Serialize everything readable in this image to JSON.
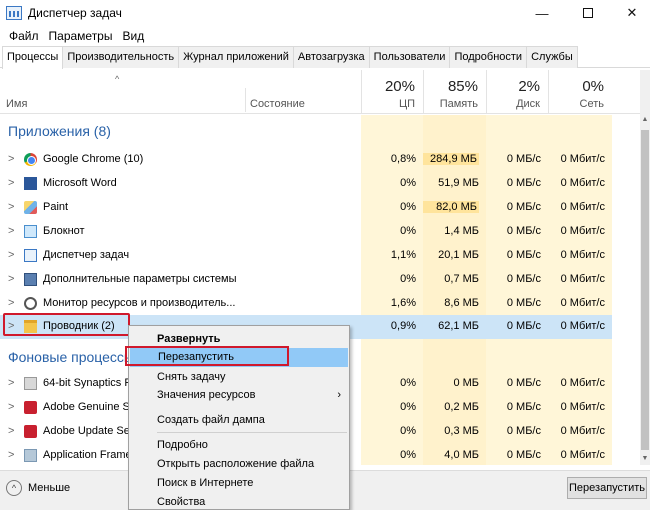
{
  "window": {
    "title": "Диспетчер задач",
    "minimize_glyph": "—",
    "close_glyph": "✕"
  },
  "menu": [
    "Файл",
    "Параметры",
    "Вид"
  ],
  "tabs": [
    "Процессы",
    "Производительность",
    "Журнал приложений",
    "Автозагрузка",
    "Пользователи",
    "Подробности",
    "Службы"
  ],
  "header": {
    "sort_glyph": "^",
    "name": "Имя",
    "state": "Состояние",
    "cpu_pct": "20%",
    "cpu_label": "ЦП",
    "mem_pct": "85%",
    "mem_label": "Память",
    "disk_pct": "2%",
    "disk_label": "Диск",
    "net_pct": "0%",
    "net_label": "Сеть"
  },
  "sections": {
    "apps": "Приложения (8)",
    "background": "Фоновые процессы"
  },
  "rows": [
    {
      "name": "Google Chrome (10)",
      "icon": "chrome-icon",
      "cpu": "0,8%",
      "mem": "284,9 МБ",
      "disk": "0 МБ/с",
      "net": "0 Мбит/с"
    },
    {
      "name": "Microsoft Word",
      "icon": "word-icon",
      "cpu": "0%",
      "mem": "51,9 МБ",
      "disk": "0 МБ/с",
      "net": "0 Мбит/с"
    },
    {
      "name": "Paint",
      "icon": "paint-icon",
      "cpu": "0%",
      "mem": "82,0 МБ",
      "disk": "0 МБ/с",
      "net": "0 Мбит/с"
    },
    {
      "name": "Блокнот",
      "icon": "notepad-icon",
      "cpu": "0%",
      "mem": "1,4 МБ",
      "disk": "0 МБ/с",
      "net": "0 Мбит/с"
    },
    {
      "name": "Диспетчер задач",
      "icon": "task-manager-icon",
      "cpu": "1,1%",
      "mem": "20,1 МБ",
      "disk": "0 МБ/с",
      "net": "0 Мбит/с"
    },
    {
      "name": "Дополнительные параметры системы",
      "icon": "system-settings-icon",
      "cpu": "0%",
      "mem": "0,7 МБ",
      "disk": "0 МБ/с",
      "net": "0 Мбит/с"
    },
    {
      "name": "Монитор ресурсов и производитель...",
      "icon": "resource-monitor-icon",
      "cpu": "1,6%",
      "mem": "8,6 МБ",
      "disk": "0 МБ/с",
      "net": "0 Мбит/с"
    },
    {
      "name": "Проводник (2)",
      "icon": "explorer-icon",
      "cpu": "0,9%",
      "mem": "62,1 МБ",
      "disk": "0 МБ/с",
      "net": "0 Мбит/с"
    }
  ],
  "bg_rows": [
    {
      "name": "64-bit Synaptics Po",
      "icon": "synaptics-icon",
      "cpu": "0%",
      "mem": "0 МБ",
      "disk": "0 МБ/с",
      "net": "0 Мбит/с"
    },
    {
      "name": "Adobe Genuine So",
      "icon": "adobe-genuine-icon",
      "cpu": "0%",
      "mem": "0,2 МБ",
      "disk": "0 МБ/с",
      "net": "0 Мбит/с"
    },
    {
      "name": "Adobe Update Serv",
      "icon": "adobe-update-icon",
      "cpu": "0%",
      "mem": "0,3 МБ",
      "disk": "0 МБ/с",
      "net": "0 Мбит/с"
    },
    {
      "name": "Application Frame",
      "icon": "app-frame-icon",
      "cpu": "0%",
      "mem": "4,0 МБ",
      "disk": "0 МБ/с",
      "net": "0 Мбит/с"
    }
  ],
  "context_menu": {
    "expand": "Развернуть",
    "restart": "Перезапустить",
    "end_task": "Снять задачу",
    "resource_values": "Значения ресурсов",
    "resource_arrow": "›",
    "create_dump": "Создать файл дампа",
    "details": "Подробно",
    "open_location": "Открыть расположение файла",
    "search_online": "Поиск в Интернете",
    "properties": "Свойства"
  },
  "bottom": {
    "less_label": "Меньше",
    "less_glyph": "^",
    "restart_button": "Перезапустить"
  },
  "colors": {
    "section_title": "#2a62a8",
    "selected_row": "#cce4f7",
    "menu_hover": "#91c9f7",
    "highlight_border": "#d0192c",
    "cpu_column": "#fff6d8",
    "memory_column": "#fff2cc"
  }
}
